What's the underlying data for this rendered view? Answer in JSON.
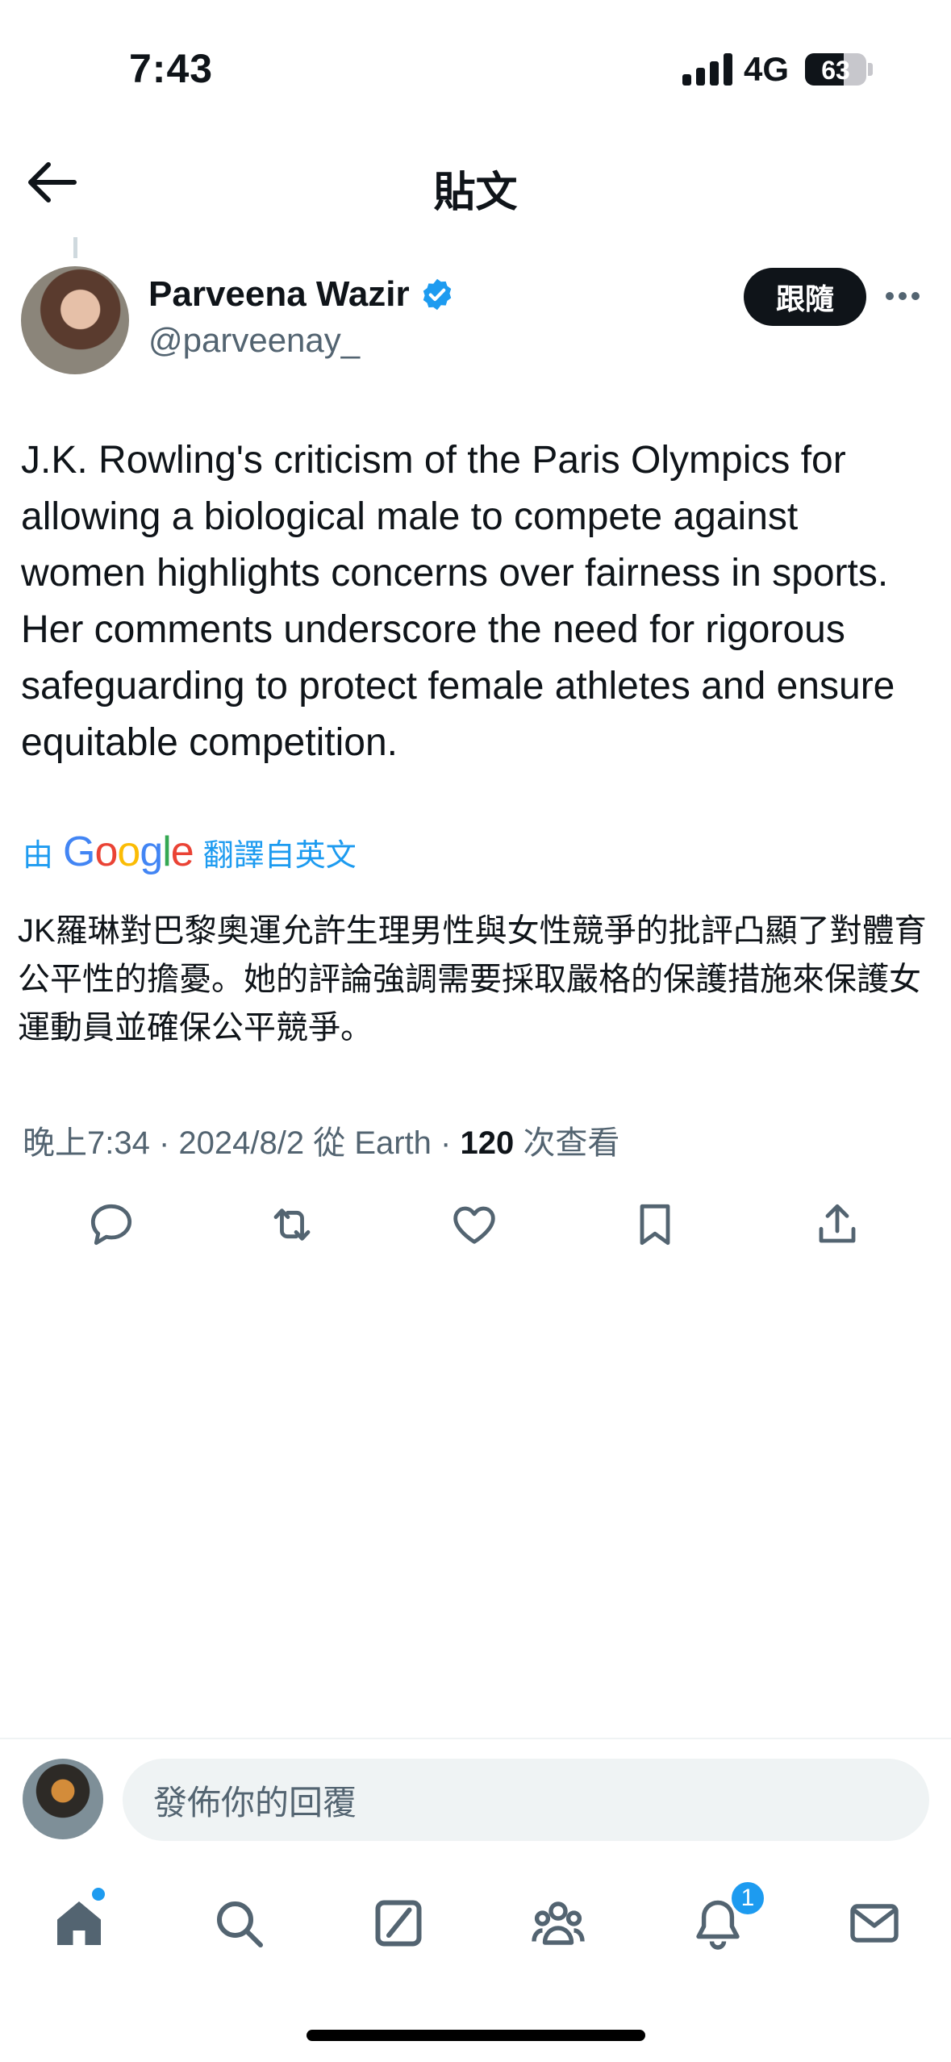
{
  "status_bar": {
    "time": "7:43",
    "network": "4G",
    "battery": "63",
    "battery_level": 0.63
  },
  "header": {
    "title": "貼文"
  },
  "tweet": {
    "author_name": "Parveena Wazir",
    "handle": "@parveenay_",
    "follow_label": "跟隨",
    "text": "J.K. Rowling's criticism of the Paris Olympics for allowing a biological male to compete against women highlights concerns over fairness in sports. Her comments underscore the need for rigorous safeguarding to protect female athletes and ensure equitable competition.",
    "translate_prefix": "由",
    "translate_brand": "Google",
    "translate_suffix": "翻譯自英文",
    "translated_text": "JK羅琳對巴黎奧運允許生理男性與女性競爭的批評凸顯了對體育公平性的擔憂。她的評論強調需要採取嚴格的保護措施來保護女運動員並確保公平競爭。",
    "meta_prefix": "晚上7:34 · 2024/8/2 從 Earth · ",
    "views_count": "120",
    "views_label": " 次查看"
  },
  "reply": {
    "placeholder": "發佈你的回覆"
  },
  "tab_bar": {
    "notification_count": "1"
  },
  "colors": {
    "accent": "#1d9bf0",
    "text": "#0f1419",
    "secondary": "#536471"
  }
}
